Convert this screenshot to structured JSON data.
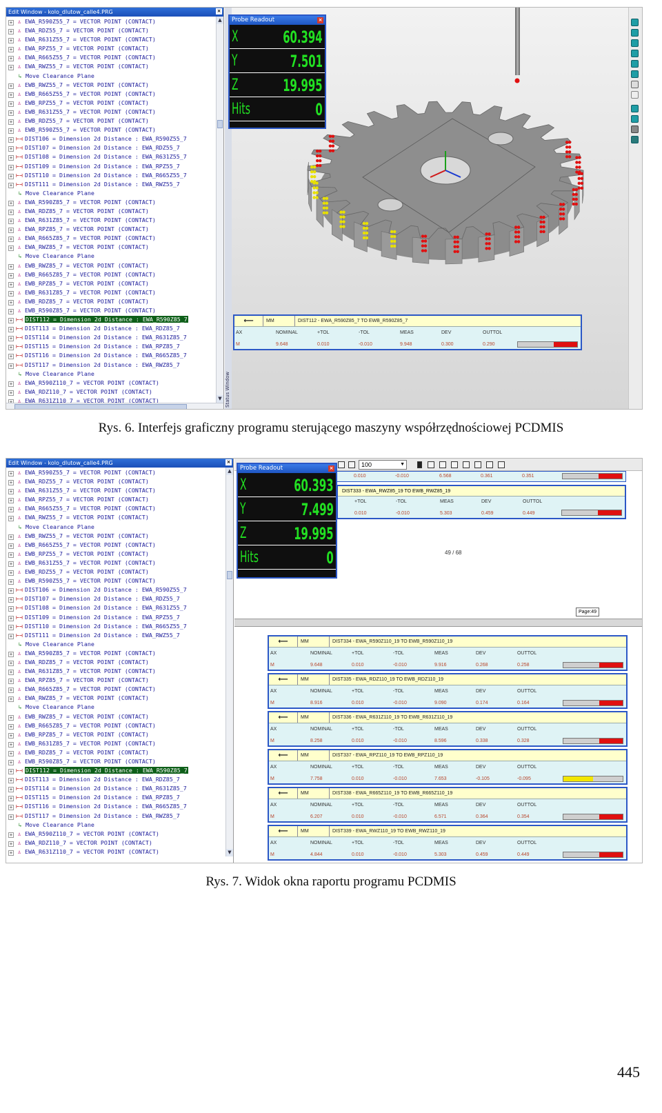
{
  "figure1": {
    "caption": "Rys. 6. Interfejs graficzny programu sterującego maszyny współrzędnościowej PCDMIS",
    "tree": {
      "title": "Edit Window - kolo_dlutow_calle4.PRG",
      "items": [
        {
          "type": "pt",
          "text": "EWA_R590Z55_7 = VECTOR POINT (CONTACT)"
        },
        {
          "type": "pt",
          "text": "EWA_RDZ55_7 = VECTOR POINT (CONTACT)"
        },
        {
          "type": "pt",
          "text": "EWA_R631Z55_7 = VECTOR POINT (CONTACT)"
        },
        {
          "type": "pt",
          "text": "EWA_RPZ55_7 = VECTOR POINT (CONTACT)"
        },
        {
          "type": "pt",
          "text": "EWA_R665Z55_7 = VECTOR POINT (CONTACT)"
        },
        {
          "type": "pt",
          "text": "EWA_RWZ55_7 = VECTOR POINT (CONTACT)"
        },
        {
          "type": "move",
          "text": "Move Clearance Plane"
        },
        {
          "type": "pt",
          "text": "EWB_RWZ55_7 = VECTOR POINT (CONTACT)"
        },
        {
          "type": "pt",
          "text": "EWB_R665Z55_7 = VECTOR POINT (CONTACT)"
        },
        {
          "type": "pt",
          "text": "EWB_RPZ55_7 = VECTOR POINT (CONTACT)"
        },
        {
          "type": "pt",
          "text": "EWB_R631Z55_7 = VECTOR POINT (CONTACT)"
        },
        {
          "type": "pt",
          "text": "EWB_RDZ55_7 = VECTOR POINT (CONTACT)"
        },
        {
          "type": "pt",
          "text": "EWB_R590Z55_7 = VECTOR POINT (CONTACT)"
        },
        {
          "type": "dist",
          "text": "DIST106 = Dimension 2d Distance : EWA_R590Z55_7"
        },
        {
          "type": "dist",
          "text": "DIST107 = Dimension 2d Distance : EWA_RDZ55_7"
        },
        {
          "type": "dist",
          "text": "DIST108 = Dimension 2d Distance : EWA_R631Z55_7"
        },
        {
          "type": "dist",
          "text": "DIST109 = Dimension 2d Distance : EWA_RPZ55_7"
        },
        {
          "type": "dist",
          "text": "DIST110 = Dimension 2d Distance : EWA_R665Z55_7"
        },
        {
          "type": "dist",
          "text": "DIST111 = Dimension 2d Distance : EWA_RWZ55_7"
        },
        {
          "type": "move",
          "text": "Move Clearance Plane"
        },
        {
          "type": "pt",
          "text": "EWA_R590Z85_7 = VECTOR POINT (CONTACT)"
        },
        {
          "type": "pt",
          "text": "EWA_RDZ85_7 = VECTOR POINT (CONTACT)"
        },
        {
          "type": "pt",
          "text": "EWA_R631Z85_7 = VECTOR POINT (CONTACT)"
        },
        {
          "type": "pt",
          "text": "EWA_RPZ85_7 = VECTOR POINT (CONTACT)"
        },
        {
          "type": "pt",
          "text": "EWA_R665Z85_7 = VECTOR POINT (CONTACT)"
        },
        {
          "type": "pt",
          "text": "EWA_RWZ85_7 = VECTOR POINT (CONTACT)"
        },
        {
          "type": "move",
          "text": "Move Clearance Plane"
        },
        {
          "type": "pt",
          "text": "EWB_RWZ85_7 = VECTOR POINT (CONTACT)"
        },
        {
          "type": "pt",
          "text": "EWB_R665Z85_7 = VECTOR POINT (CONTACT)"
        },
        {
          "type": "pt",
          "text": "EWB_RPZ85_7 = VECTOR POINT (CONTACT)"
        },
        {
          "type": "pt",
          "text": "EWB_R631Z85_7 = VECTOR POINT (CONTACT)"
        },
        {
          "type": "pt",
          "text": "EWB_RDZ85_7 = VECTOR POINT (CONTACT)"
        },
        {
          "type": "pt",
          "text": "EWB_R590Z85_7 = VECTOR POINT (CONTACT)"
        },
        {
          "type": "dist",
          "selected": true,
          "text": "DIST112 = Dimension 2d Distance : EWA_R590Z85_7"
        },
        {
          "type": "dist",
          "text": "DIST113 = Dimension 2d Distance : EWA_RDZ85_7"
        },
        {
          "type": "dist",
          "text": "DIST114 = Dimension 2d Distance : EWA_R631Z85_7"
        },
        {
          "type": "dist",
          "text": "DIST115 = Dimension 2d Distance : EWA_RPZ85_7"
        },
        {
          "type": "dist",
          "text": "DIST116 = Dimension 2d Distance : EWA_R665Z85_7"
        },
        {
          "type": "dist",
          "text": "DIST117 = Dimension 2d Distance : EWA_RWZ85_7"
        },
        {
          "type": "move",
          "text": "Move Clearance Plane"
        },
        {
          "type": "pt",
          "text": "EWA_R590Z110_7 = VECTOR POINT (CONTACT)"
        },
        {
          "type": "pt",
          "text": "EWA_RDZ110_7 = VECTOR POINT (CONTACT)"
        },
        {
          "type": "pt",
          "text": "EWA_R631Z110_7 = VECTOR POINT (CONTACT)"
        }
      ],
      "side_label": "Status Window"
    },
    "probe": {
      "title": "Probe Readout",
      "rows": [
        {
          "label": "X",
          "value": "60.394"
        },
        {
          "label": "Y",
          "value": "7.501"
        },
        {
          "label": "Z",
          "value": "19.995"
        },
        {
          "label": "Hits",
          "value": "0"
        }
      ]
    },
    "dim": {
      "unit": "MM",
      "name": "DIST112 - EWA_R590Z85_7 TO EWB_R590Z85_7",
      "headers": [
        "AX",
        "NOMINAL",
        "+TOL",
        "-TOL",
        "MEAS",
        "DEV",
        "OUTTOL"
      ],
      "values": [
        "M",
        "9.648",
        "0.010",
        "-0.010",
        "9.948",
        "0.300",
        "0.290"
      ]
    }
  },
  "figure2": {
    "caption": "Rys. 7. Widok okna raportu programu PCDMIS",
    "tree": {
      "title": "Edit Window - kolo_dlutow_calle4.PRG",
      "items": [
        {
          "type": "pt",
          "text": "EWA_R590Z55_7 = VECTOR POINT (CONTACT)"
        },
        {
          "type": "pt",
          "text": "EWA_RDZ55_7 = VECTOR POINT (CONTACT)"
        },
        {
          "type": "pt",
          "text": "EWA_R631Z55_7 = VECTOR POINT (CONTACT)"
        },
        {
          "type": "pt",
          "text": "EWA_RPZ55_7 = VECTOR POINT (CONTACT)"
        },
        {
          "type": "pt",
          "text": "EWA_R665Z55_7 = VECTOR POINT (CONTACT)"
        },
        {
          "type": "pt",
          "text": "EWA_RWZ55_7 = VECTOR POINT (CONTACT)"
        },
        {
          "type": "move",
          "text": "Move Clearance Plane"
        },
        {
          "type": "pt",
          "text": "EWB_RWZ55_7 = VECTOR POINT (CONTACT)"
        },
        {
          "type": "pt",
          "text": "EWB_R665Z55_7 = VECTOR POINT (CONTACT)"
        },
        {
          "type": "pt",
          "text": "EWB_RPZ55_7 = VECTOR POINT (CONTACT)"
        },
        {
          "type": "pt",
          "text": "EWB_R631Z55_7 = VECTOR POINT (CONTACT)"
        },
        {
          "type": "pt",
          "text": "EWB_RDZ55_7 = VECTOR POINT (CONTACT)"
        },
        {
          "type": "pt",
          "text": "EWB_R590Z55_7 = VECTOR POINT (CONTACT)"
        },
        {
          "type": "dist",
          "text": "DIST106 = Dimension 2d Distance : EWA_R590Z55_7"
        },
        {
          "type": "dist",
          "text": "DIST107 = Dimension 2d Distance : EWA_RDZ55_7"
        },
        {
          "type": "dist",
          "text": "DIST108 = Dimension 2d Distance : EWA_R631Z55_7"
        },
        {
          "type": "dist",
          "text": "DIST109 = Dimension 2d Distance : EWA_RPZ55_7"
        },
        {
          "type": "dist",
          "text": "DIST110 = Dimension 2d Distance : EWA_R665Z55_7"
        },
        {
          "type": "dist",
          "text": "DIST111 = Dimension 2d Distance : EWA_RWZ55_7"
        },
        {
          "type": "move",
          "text": "Move Clearance Plane"
        },
        {
          "type": "pt",
          "text": "EWA_R590Z85_7 = VECTOR POINT (CONTACT)"
        },
        {
          "type": "pt",
          "text": "EWA_RDZ85_7 = VECTOR POINT (CONTACT)"
        },
        {
          "type": "pt",
          "text": "EWA_R631Z85_7 = VECTOR POINT (CONTACT)"
        },
        {
          "type": "pt",
          "text": "EWA_RPZ85_7 = VECTOR POINT (CONTACT)"
        },
        {
          "type": "pt",
          "text": "EWA_R665Z85_7 = VECTOR POINT (CONTACT)"
        },
        {
          "type": "pt",
          "text": "EWA_RWZ85_7 = VECTOR POINT (CONTACT)"
        },
        {
          "type": "move",
          "text": "Move Clearance Plane"
        },
        {
          "type": "pt",
          "text": "EWB_RWZ85_7 = VECTOR POINT (CONTACT)"
        },
        {
          "type": "pt",
          "text": "EWB_R665Z85_7 = VECTOR POINT (CONTACT)"
        },
        {
          "type": "pt",
          "text": "EWB_RPZ85_7 = VECTOR POINT (CONTACT)"
        },
        {
          "type": "pt",
          "text": "EWB_R631Z85_7 = VECTOR POINT (CONTACT)"
        },
        {
          "type": "pt",
          "text": "EWB_RDZ85_7 = VECTOR POINT (CONTACT)"
        },
        {
          "type": "pt",
          "text": "EWB_R590Z85_7 = VECTOR POINT (CONTACT)"
        },
        {
          "type": "dist",
          "selected": true,
          "text": "DIST112 = Dimension 2d Distance : EWA_R590Z85_7"
        },
        {
          "type": "dist",
          "text": "DIST113 = Dimension 2d Distance : EWA_RDZ85_7"
        },
        {
          "type": "dist",
          "text": "DIST114 = Dimension 2d Distance : EWA_R631Z85_7"
        },
        {
          "type": "dist",
          "text": "DIST115 = Dimension 2d Distance : EWA_RPZ85_7"
        },
        {
          "type": "dist",
          "text": "DIST116 = Dimension 2d Distance : EWA_R665Z85_7"
        },
        {
          "type": "dist",
          "text": "DIST117 = Dimension 2d Distance : EWA_RWZ85_7"
        },
        {
          "type": "move",
          "text": "Move Clearance Plane"
        },
        {
          "type": "pt",
          "text": "EWA_R590Z110_7 = VECTOR POINT (CONTACT)"
        },
        {
          "type": "pt",
          "text": "EWA_RDZ110_7 = VECTOR POINT (CONTACT)"
        },
        {
          "type": "pt",
          "text": "EWA_R631Z110_7 = VECTOR POINT (CONTACT)"
        }
      ]
    },
    "probe": {
      "title": "Probe Readout",
      "rows": [
        {
          "label": "X",
          "value": "60.393"
        },
        {
          "label": "Y",
          "value": "7.499"
        },
        {
          "label": "Z",
          "value": "19.995"
        },
        {
          "label": "Hits",
          "value": "0"
        }
      ]
    },
    "toolbar": {
      "zoom": "100"
    },
    "upper": {
      "partial_values": [
        "0.010",
        "-0.010",
        "6.568",
        "0.361",
        "0.351"
      ],
      "dim_name": "DIST333 - EWA_RWZ85_19 TO EWB_RWZ85_19",
      "headers": [
        "+TOL",
        "-TOL",
        "MEAS",
        "DEV",
        "OUTTOL"
      ],
      "values": [
        "0.010",
        "-0.010",
        "5.303",
        "0.459",
        "0.449"
      ],
      "page_counter": "49  /  68",
      "page_label": "Page:49"
    },
    "dims": [
      {
        "unit": "MM",
        "name": "DIST334 - EWA_R590Z110_19 TO EWB_R590Z110_19",
        "headers": [
          "AX",
          "NOMINAL",
          "+TOL",
          "-TOL",
          "MEAS",
          "DEV",
          "OUTTOL"
        ],
        "values": [
          "M",
          "9.648",
          "0.010",
          "-0.010",
          "9.916",
          "0.268",
          "0.258"
        ],
        "bar": "red"
      },
      {
        "unit": "MM",
        "name": "DIST335 - EWA_RDZ110_19 TO EWB_RDZ110_19",
        "headers": [
          "AX",
          "NOMINAL",
          "+TOL",
          "-TOL",
          "MEAS",
          "DEV",
          "OUTTOL"
        ],
        "values": [
          "M",
          "8.916",
          "0.010",
          "-0.010",
          "9.090",
          "0.174",
          "0.164"
        ],
        "bar": "red"
      },
      {
        "unit": "MM",
        "name": "DIST336 - EWA_R631Z110_19 TO EWB_R631Z110_19",
        "headers": [
          "AX",
          "NOMINAL",
          "+TOL",
          "-TOL",
          "MEAS",
          "DEV",
          "OUTTOL"
        ],
        "values": [
          "M",
          "8.258",
          "0.010",
          "-0.010",
          "8.596",
          "0.338",
          "0.328"
        ],
        "bar": "red"
      },
      {
        "unit": "MM",
        "name": "DIST337 - EWA_RPZ110_19 TO EWB_RPZ110_19",
        "headers": [
          "AX",
          "NOMINAL",
          "+TOL",
          "-TOL",
          "MEAS",
          "DEV",
          "OUTTOL"
        ],
        "values": [
          "M",
          "7.758",
          "0.010",
          "-0.010",
          "7.653",
          "-0.105",
          "-0.095"
        ],
        "bar": "yellow"
      },
      {
        "unit": "MM",
        "name": "DIST338 - EWA_R665Z110_19 TO EWB_R665Z110_19",
        "headers": [
          "AX",
          "NOMINAL",
          "+TOL",
          "-TOL",
          "MEAS",
          "DEV",
          "OUTTOL"
        ],
        "values": [
          "M",
          "6.207",
          "0.010",
          "-0.010",
          "6.571",
          "0.364",
          "0.354"
        ],
        "bar": "red"
      },
      {
        "unit": "MM",
        "name": "DIST339 - EWA_RWZ110_19 TO EWB_RWZ110_19",
        "headers": [
          "AX",
          "NOMINAL",
          "+TOL",
          "-TOL",
          "MEAS",
          "DEV",
          "OUTTOL"
        ],
        "values": [
          "M",
          "4.844",
          "0.010",
          "-0.010",
          "5.303",
          "0.459",
          "0.449"
        ],
        "bar": "red"
      }
    ]
  },
  "page_number": "445",
  "colors": {
    "title_bar": "#1f56c3",
    "probe_digits": "#22e022",
    "selection": "#0e5f19",
    "out_of_tolerance": "#e01010",
    "warning": "#f2e600"
  }
}
